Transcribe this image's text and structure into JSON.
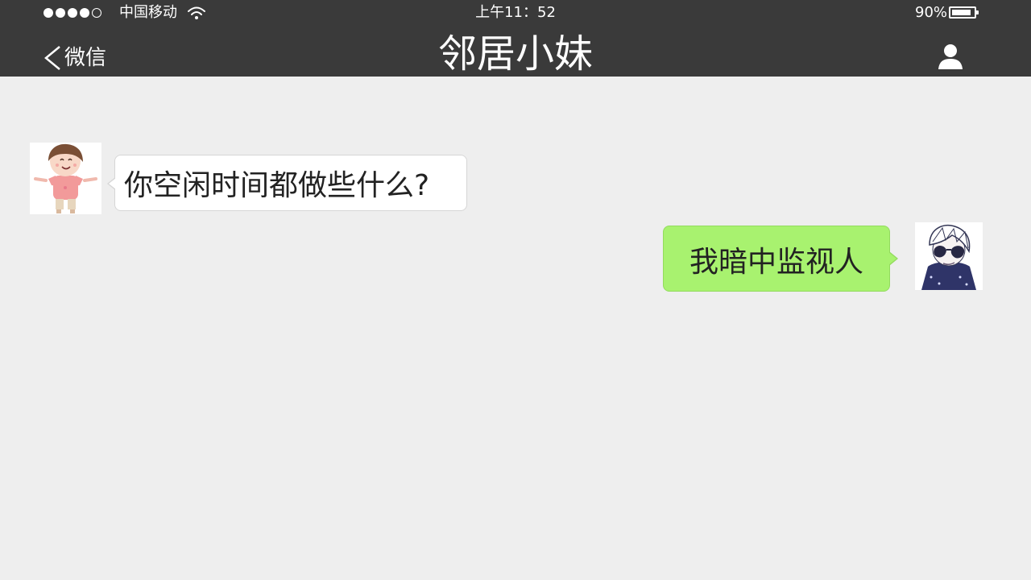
{
  "status_bar": {
    "carrier": "中国移动",
    "time": "上午11：52",
    "battery_percent": "90%",
    "battery_level": 0.9,
    "signal_strength": 4,
    "signal_max": 5
  },
  "nav": {
    "back_label": "微信",
    "title": "邻居小妹",
    "back_icon": "chevron-left-icon",
    "profile_icon": "person-icon"
  },
  "messages": [
    {
      "side": "left",
      "text": "你空闲时间都做些什么?"
    },
    {
      "side": "right",
      "text": "我暗中监视人"
    }
  ],
  "colors": {
    "topbar": "#3a3a3a",
    "chat_background": "#eeeeee",
    "incoming_bubble": "#ffffff",
    "outgoing_bubble": "#a8f26f"
  }
}
